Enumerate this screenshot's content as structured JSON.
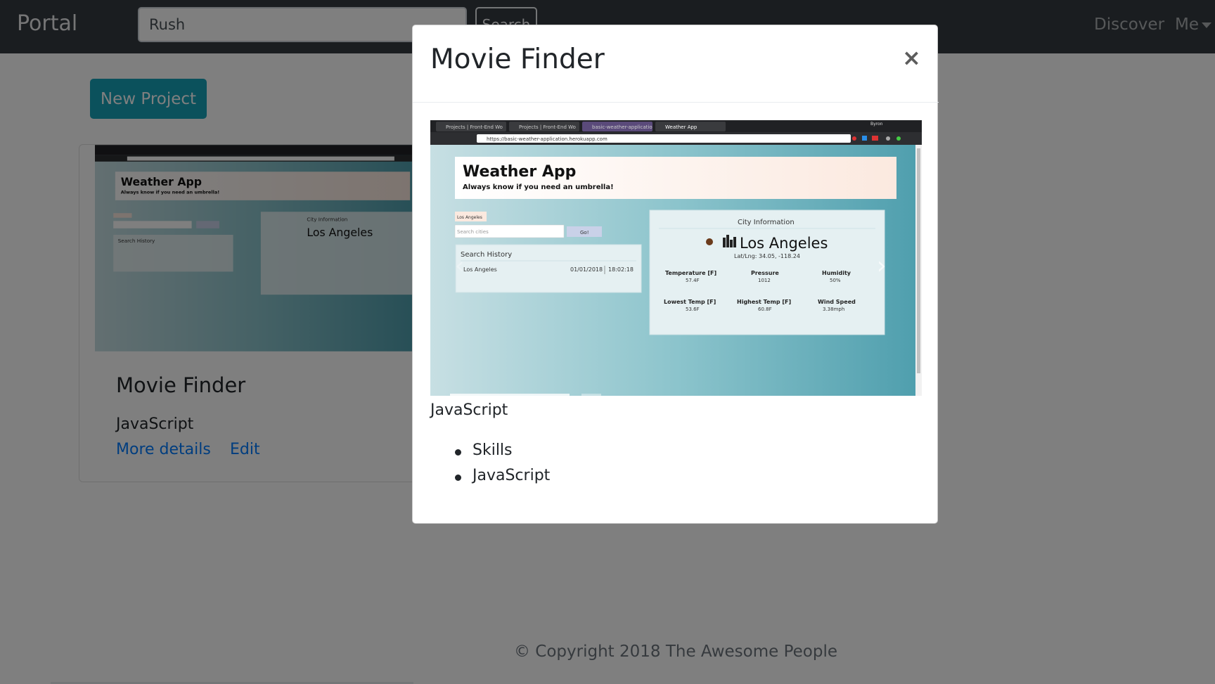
{
  "navbar": {
    "brand": "Portal",
    "search_value": "Rush",
    "search_button": "Search",
    "discover": "Discover",
    "me": "Me"
  },
  "page": {
    "new_project_button": "New Project",
    "card": {
      "title": "Movie Finder",
      "tag": "JavaScript",
      "more_details": "More details",
      "edit": "Edit"
    },
    "footer": "© Copyright 2018 The Awesome People"
  },
  "screenshot": {
    "browser_tabs": [
      "Projects | Front-End Wo",
      "Projects | Front-End Wo",
      "basic-weather-applicatio",
      "Weather App"
    ],
    "url": "https://basic-weather-application.herokuapp.com",
    "user_name": "Byron",
    "app_title": "Weather App",
    "app_subtitle": "Always know if you need an umbrella!",
    "city_chip": "Los Angeles",
    "search_placeholder": "Search cities",
    "go_button": "Go!",
    "history_title": "Search History",
    "history_city": "Los Angeles",
    "history_date": "01/01/2018",
    "history_time": "18:02:18",
    "info_title": "City Information",
    "info_city": "Los Angeles",
    "info_latlng": "Lat/Lng: 34.05, -118.24",
    "temp_label": "Temperature [F]",
    "temp_value": "57.4F",
    "pressure_label": "Pressure",
    "pressure_value": "1012",
    "humidity_label": "Humidity",
    "humidity_value": "50%",
    "low_label": "Lowest Temp [F]",
    "low_value": "53.6F",
    "high_label": "Highest Temp [F]",
    "high_value": "60.8F",
    "wind_label": "Wind Speed",
    "wind_value": "3.38mph"
  },
  "modal": {
    "title": "Movie Finder",
    "close": "×",
    "tag": "JavaScript",
    "list": [
      "Skills",
      "JavaScript"
    ],
    "carousel_next": "›",
    "carousel_prev": "‹"
  },
  "colors": {
    "navbar": "#343a40",
    "button_info": "#17a2b8",
    "link": "#007bff",
    "teal_gradient_start": "#d2e4e6",
    "teal_gradient_end": "#4f9fae"
  }
}
